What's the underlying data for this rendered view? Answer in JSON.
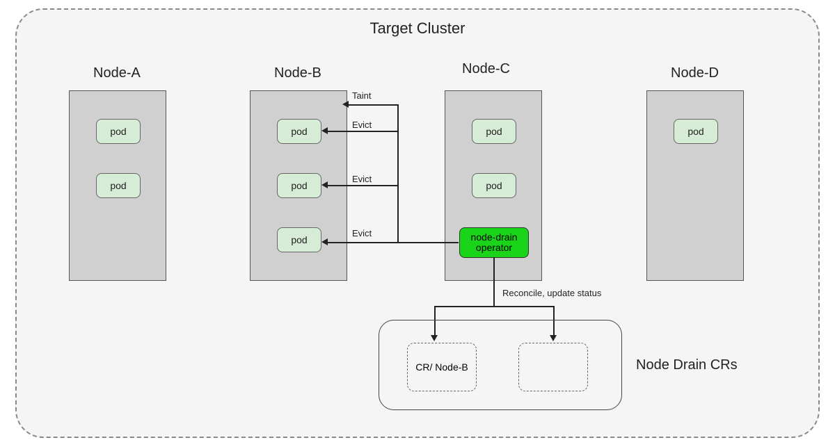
{
  "cluster": {
    "title": "Target Cluster"
  },
  "nodes": {
    "a": {
      "label": "Node-A",
      "pods": [
        "pod",
        "pod"
      ]
    },
    "b": {
      "label": "Node-B",
      "pods": [
        "pod",
        "pod",
        "pod"
      ]
    },
    "c": {
      "label": "Node-C",
      "pods": [
        "pod",
        "pod"
      ]
    },
    "d": {
      "label": "Node-D",
      "pods": [
        "pod"
      ]
    }
  },
  "operator": {
    "label": "node-drain operator"
  },
  "actions": {
    "taint": "Taint",
    "evict1": "Evict",
    "evict2": "Evict",
    "evict3": "Evict",
    "reconcile": "Reconcile, update status"
  },
  "crs": {
    "container_label": "Node Drain CRs",
    "cr1": "CR/ Node-B",
    "cr2": ""
  }
}
